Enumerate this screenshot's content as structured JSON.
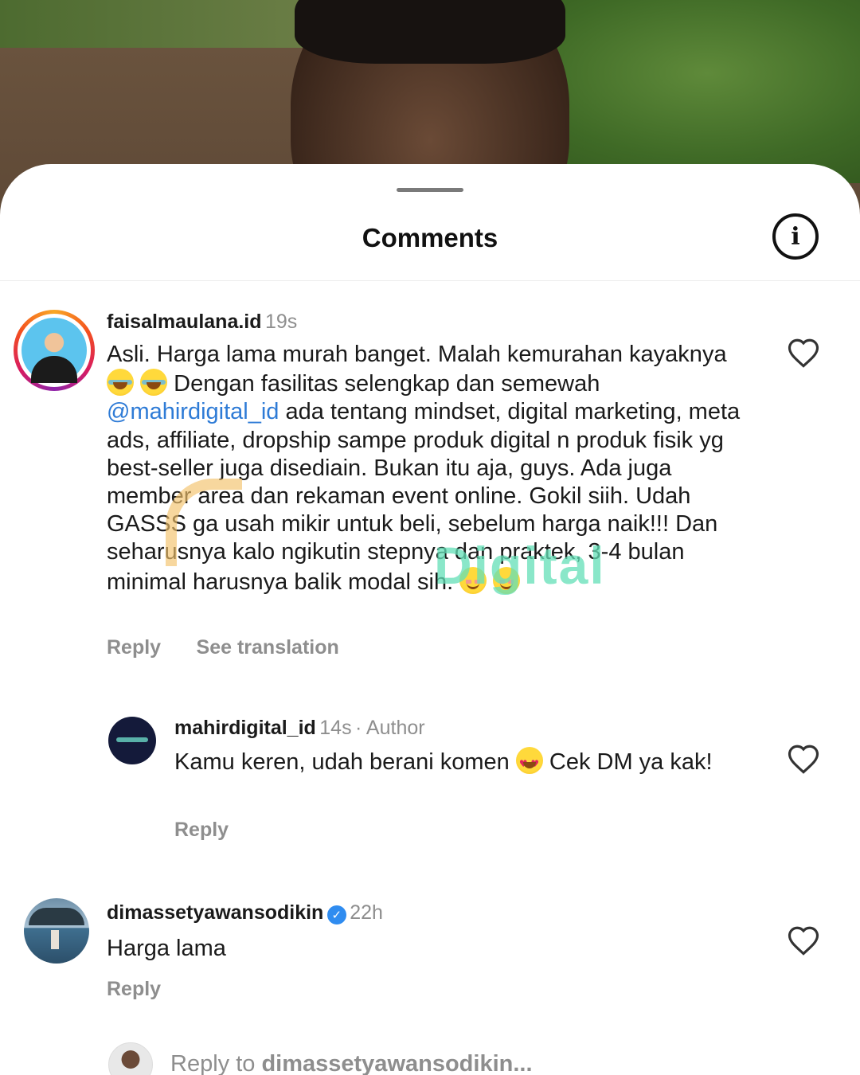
{
  "sheet": {
    "title": "Comments",
    "info_icon": "info-icon"
  },
  "watermark": "Digital",
  "comments": [
    {
      "username": "faisalmaulana.id",
      "time": "19s",
      "text_parts": [
        "Asli. Harga lama murah banget. Malah kemurahan kayaknya ",
        " Dengan fasilitas selengkap dan semewah ",
        "@mahirdigital_id",
        " ada tentang mindset, digital marketing, meta ads, affiliate, dropship sampe produk digital n produk fisik yg best-seller juga disediain. Bukan itu aja, guys. Ada juga member area dan rekaman event online. Gokil siih. Udah GASSS ga usah mikir untuk beli, sebelum harga naik!!! Dan seharusnya kalo ngikutin stepnya dan praktek, 3-4 bulan minimal harusnya balik modal sih. "
      ],
      "emojis": [
        "face-with-tears-of-joy",
        "face-with-tears-of-joy",
        "smiling-face",
        "smiling-face"
      ],
      "reply_label": "Reply",
      "translate_label": "See translation"
    },
    {
      "username": "mahirdigital_id",
      "time": "14s",
      "author_tag": "· Author",
      "text_parts": [
        "Kamu keren, udah berani komen ",
        " Cek DM ya kak!"
      ],
      "emojis": [
        "heart-eyes-face"
      ],
      "reply_label": "Reply"
    },
    {
      "username": "dimassetyawansodikin",
      "verified": true,
      "time": "22h",
      "text": "Harga lama",
      "reply_label": "Reply"
    }
  ],
  "reply_bar": {
    "prefix": "Reply to ",
    "target": "dimassetyawansodikin..."
  },
  "colors": {
    "mention": "#2e7bd6",
    "muted": "#8e8e8e",
    "verified": "#2f8cf0",
    "watermark": "#63e0b7"
  }
}
